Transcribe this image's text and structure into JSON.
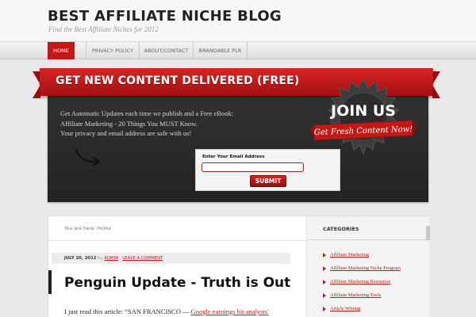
{
  "header": {
    "title": "BEST AFFILIATE NICHE BLOG",
    "description": "Find the Best Affiliate Niches for 2012"
  },
  "nav": {
    "items": [
      {
        "label": "HOME",
        "active": true
      },
      {
        "label": "PRIVACY POLICY",
        "active": false
      },
      {
        "label": "ABOUT/CONTACT",
        "active": false
      },
      {
        "label": "BRANDABLE PLR",
        "active": false
      }
    ]
  },
  "optin": {
    "heading": "GET NEW CONTENT DELIVERED (FREE)",
    "line1": "Get Automatic Updates each time we publish and a Free eBook:",
    "line2": "Affiliate Marketing - 20 Things You MUST Know.",
    "line3": "Your privacy and email address are safe with us!",
    "badge_title": "JOIN US",
    "badge_ribbon": "Get Fresh Content Now!",
    "form_label": "Enter Your Email Address",
    "email_value": "",
    "submit_label": "SUBMIT"
  },
  "breadcrumb": "You are here: Home",
  "post": {
    "date": "JULY 20, 2012",
    "by": "by",
    "author": "ADMIN",
    "separator": "·",
    "comment_link": "LEAVE A COMMENT",
    "title": "Penguin Update - Truth is Out",
    "excerpt_start": "I just read this article:  “SAN FRANCISCO — ",
    "excerpt_link": "Google earnings hit analysts'"
  },
  "sidebar": {
    "heading": "CATEGORIES",
    "categories": [
      "Affiliate Marketing",
      "Affiliate Marketing Niche Program",
      "Affiliate Marketing Resources",
      "Affiliate Marketing Tools",
      "Article Writing"
    ]
  },
  "colors": {
    "accent": "#c41717",
    "dark_band": "#2b2b2b"
  }
}
